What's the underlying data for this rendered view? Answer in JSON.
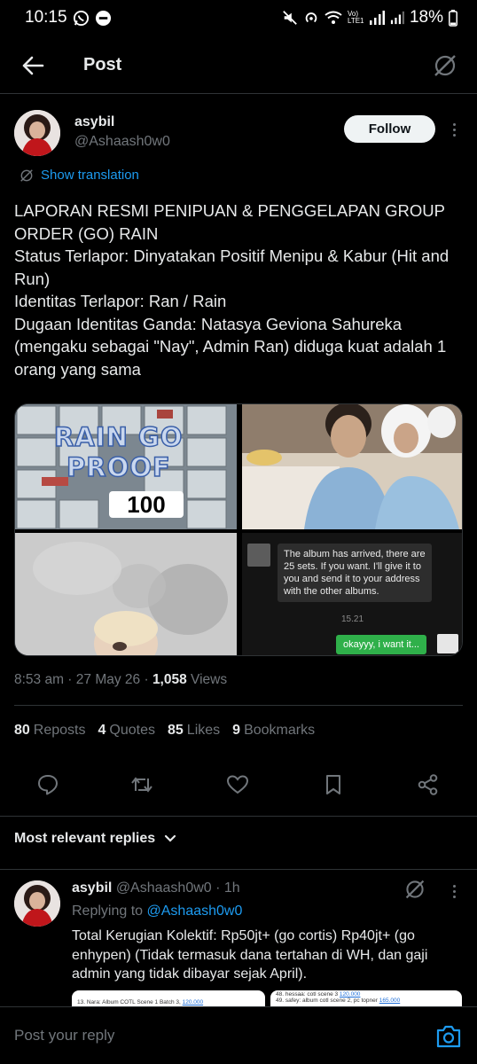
{
  "status_bar": {
    "time": "10:15",
    "network": "Vo) LTE1",
    "battery": "18%"
  },
  "header": {
    "title": "Post"
  },
  "post": {
    "author_name": "asybil",
    "author_handle": "@Ashaash0w0",
    "follow_label": "Follow",
    "translation_label": "Show translation",
    "text_lines": [
      "LAPORAN RESMI PENIPUAN & PENGGELAPAN GROUP ORDER (GO) RAIN",
      "Status Terlapor: Dinyatakan Positif Menipu & Kabur (Hit and Run)",
      "Identitas Terlapor: Ran / Rain",
      "Dugaan Identitas Ganda: Natasya Geviona Sahureka (mengaku sebagai \"Nay\", Admin Ran) diduga kuat adalah 1 orang yang sama"
    ],
    "media": {
      "image1_overlay_line1": "RAIN GO",
      "image1_overlay_line2": "PROOF",
      "image1_badge": "100",
      "chat_incoming": "The album has arrived, there are 25 sets. If you want. I'll give it to you and send it to your address with the other albums.",
      "chat_time": "15.21",
      "chat_outgoing": "okayyy, i want it..."
    },
    "timestamp": "8:53 am · 27 May 26 · ",
    "views_count": "1,058",
    "views_label": " Views",
    "stats": {
      "reposts_count": "80",
      "reposts_label": "Reposts",
      "quotes_count": "4",
      "quotes_label": "Quotes",
      "likes_count": "85",
      "likes_label": "Likes",
      "bookmarks_count": "9",
      "bookmarks_label": "Bookmarks"
    }
  },
  "replies_filter": "Most relevant replies",
  "reply": {
    "author_name": "asybil",
    "author_handle": "@Ashaash0w0",
    "time": "· 1h",
    "replying_prefix": "Replying to ",
    "replying_handle": "@Ashaash0w0",
    "text": "Total Kerugian Kolektif: Rp50jt+ (go cortis) Rp40jt+ (go enhypen) (Tidak termasuk dana tertahan di WH, dan gaji admin yang tidak dibayar sejak April).",
    "image_left_text": "13. Nara: Album COTL Scene 1 Batch 3,",
    "image_left_amount": "120.000",
    "image_right_top": "48. hessaa: cotl scene 3",
    "image_right_top_amount": "120.000",
    "image_right_text": "49. safey: album cotl scene 2, pc topner",
    "image_right_amount": "165.000"
  },
  "composer": {
    "placeholder": "Post your reply"
  },
  "colors": {
    "background": "#000000",
    "text_primary": "#e7e9ea",
    "text_secondary": "#71767b",
    "accent": "#1d9bf0",
    "divider": "#2f3336"
  }
}
